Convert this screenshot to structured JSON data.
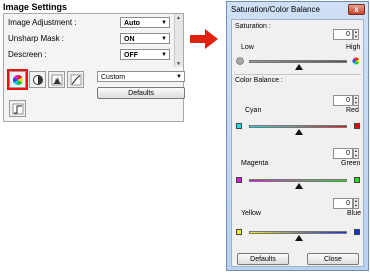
{
  "image_settings": {
    "title": "Image Settings",
    "rows": [
      {
        "label": "Image Adjustment :",
        "value": "Auto"
      },
      {
        "label": "Unsharp Mask :",
        "value": "ON"
      },
      {
        "label": "Descreen :",
        "value": "OFF"
      }
    ],
    "preset": "Custom",
    "defaults_label": "Defaults"
  },
  "dialog": {
    "title": "Saturation/Color Balance",
    "close_glyph": "x",
    "saturation": {
      "label": "Saturation :",
      "value": "0",
      "low": "Low",
      "high": "High"
    },
    "color_balance_label": "Color Balance :",
    "cyan_red": {
      "left": "Cyan",
      "right": "Red",
      "value": "0"
    },
    "magenta_green": {
      "left": "Magenta",
      "right": "Green",
      "value": "0"
    },
    "yellow_blue": {
      "left": "Yellow",
      "right": "Blue",
      "value": "0"
    },
    "defaults_label": "Defaults",
    "close_label": "Close"
  },
  "colors": {
    "highlight": "#e11111",
    "arrow": "#e02010",
    "cyan": "#19e0e8",
    "red": "#e01010",
    "magenta": "#e010e0",
    "green": "#20e020",
    "yellow": "#f0f010",
    "blue": "#1030e0"
  }
}
